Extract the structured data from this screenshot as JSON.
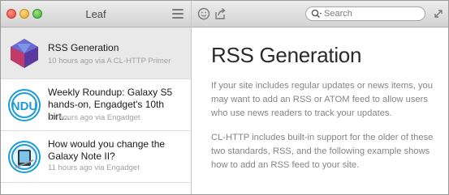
{
  "window": {
    "title": "Leaf"
  },
  "toolbar": {
    "search_placeholder": "Search",
    "icons": [
      "close-traffic-light",
      "minimize-traffic-light",
      "zoom-traffic-light",
      "menu-icon",
      "smiley-icon",
      "share-icon",
      "search-icon",
      "expand-icon"
    ]
  },
  "feed": {
    "items": [
      {
        "title": "RSS Generation",
        "meta": "10 hours ago via A CL-HTTP Primer",
        "icon": "cube-thumbnail",
        "selected": true
      },
      {
        "title": "Weekly Roundup: Galaxy S5 hands-on, Engadget's 10th birt...",
        "meta": "10 hours ago via Engadget",
        "icon": "engadget-thumbnail",
        "thumb_text": "NDU",
        "selected": false
      },
      {
        "title": "How would you change the Galaxy Note II?",
        "meta": "11 hours ago via Engadget",
        "icon": "engadget-thumbnail",
        "selected": false
      }
    ]
  },
  "article": {
    "title": "RSS Generation",
    "paragraphs": [
      "If your site includes regular updates or news items, you may want to add an RSS or ATOM feed to allow users who use news readers to track your updates.",
      "CL-HTTP includes built-in support for the older of these two standards, RSS, and the following example shows how to add an RSS feed to your site."
    ]
  },
  "colors": {
    "accent": "#1e9bd6",
    "meta_text": "#a0a0a0",
    "body_text": "#858585"
  }
}
